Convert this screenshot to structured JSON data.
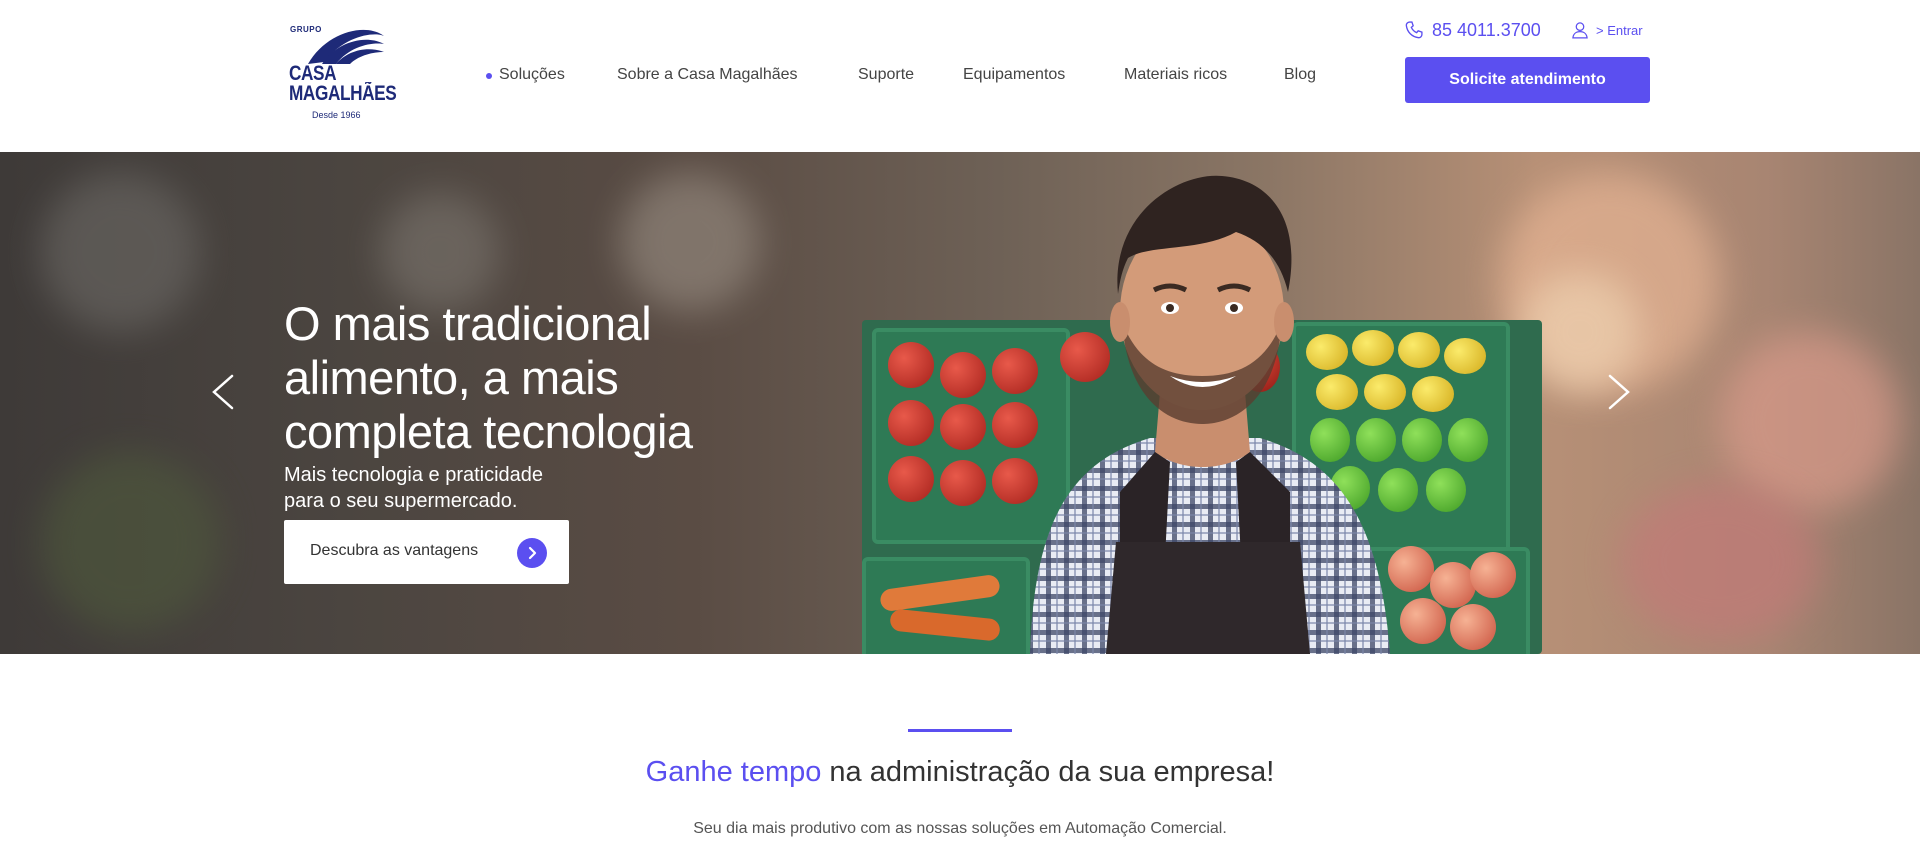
{
  "header": {
    "logo": {
      "grupo": "GRUPO",
      "line1": "CASA",
      "line2": "MAGALHÃES",
      "since": "Desde 1966",
      "color": "#1e2a78"
    },
    "nav": [
      {
        "label": "Soluções",
        "active": true
      },
      {
        "label": "Sobre a Casa Magalhães"
      },
      {
        "label": "Suporte"
      },
      {
        "label": "Equipamentos"
      },
      {
        "label": "Materiais ricos"
      },
      {
        "label": "Blog"
      }
    ],
    "phone": "85 4011.3700",
    "phone_icon": "phone-icon",
    "login_label": "> Entrar",
    "login_icon": "user-icon",
    "cta_label": "Solicite atendimento",
    "accent_color": "#5b4ff0"
  },
  "hero": {
    "title_lines": [
      "O mais tradicional",
      "alimento, a mais",
      "completa tecnologia"
    ],
    "subtitle_lines": [
      "Mais tecnologia e praticidade",
      "para o seu supermercado."
    ],
    "button_label": "Descubra as vantagens",
    "prev_icon": "chevron-left-icon",
    "next_icon": "chevron-right-icon"
  },
  "section": {
    "headline_accent": "Ganhe tempo",
    "headline_rest": " na administração da sua empresa!",
    "subtitle": "Seu dia mais produtivo com as nossas soluções em Automação Comercial."
  }
}
